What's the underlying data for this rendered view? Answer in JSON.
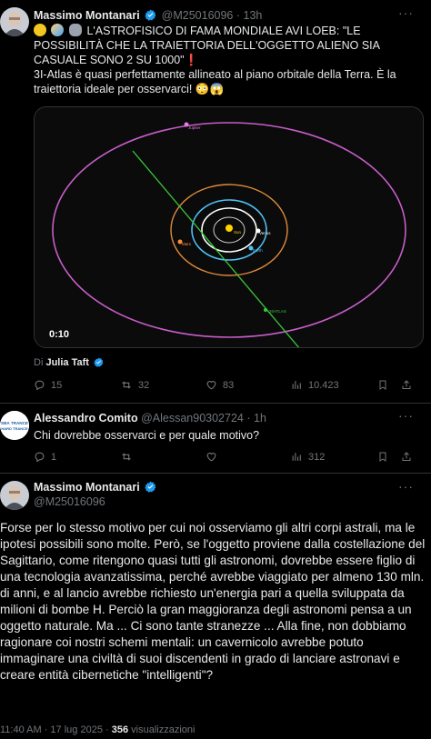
{
  "tweet1": {
    "author_name": "Massimo Montanari",
    "author_handle": "@M25016096",
    "time": "13h",
    "text_line1": "L'ASTROFISICO DI FAMA MONDIALE AVI LOEB: \"LE POSSIBILITÀ CHE LA TRAIETTORIA DELL'OGGETTO ALIENO SIA CASUALE SONO 2 SU 1000\"",
    "exclamation": "❗",
    "text_line2": "3I-Atlas è quasi perfettamente allineato al piano orbitale della Terra. È la traiettoria ideale per  osservarci!",
    "emojis": [
      "😳",
      "😱"
    ],
    "video_time": "0:10",
    "video_labels": {
      "jupiter": "Jupiter",
      "mars": "Mars",
      "venus": "Venus",
      "earth": "Earth",
      "sun": "Sun",
      "atlas": "3I/ATLAS"
    },
    "by_prefix": "Di",
    "by_name": "Julia Taft",
    "replies": "15",
    "reposts": "32",
    "likes": "83",
    "views": "10.423"
  },
  "reply": {
    "author_name": "Alessandro Comito",
    "author_handle": "@Alessan90302724",
    "time": "1h",
    "avatar_text_1": "SBA TRANCE",
    "avatar_text_2": "HARD TRANCE",
    "text": "Chi dovrebbe osservarci e per quale motivo?",
    "replies": "1",
    "views": "312"
  },
  "main": {
    "author_name": "Massimo Montanari",
    "author_handle": "@M25016096",
    "text": "Forse per lo stesso motivo per cui noi osserviamo gli altri corpi astrali, ma le ipotesi possibili sono molte. Però, se l'oggetto proviene dalla costellazione del Sagittario, come ritengono quasi tutti gli astronomi, dovrebbe essere figlio di una tecnologia avanzatissima, perché avrebbe viaggiato per almeno 130 mln. di anni, e al lancio avrebbe richiesto un'energia pari a quella sviluppata da milioni di bombe H. Perciò la gran maggioranza degli astronomi pensa a un oggetto naturale. Ma ... Ci sono tante stranezze ... Alla fine, non dobbiamo ragionare coi nostri schemi mentali: un cavernicolo avrebbe potuto immaginare una civiltà di suoi discendenti in grado di lanciare astronavi e creare entità cibernetiche \"intelligenti\"?",
    "time": "11:40 AM · 17 lug 2025 · ",
    "views_count": "356",
    "views_label": " visualizzazioni"
  },
  "colors": {
    "background": "#000000",
    "text": "#e7e9ea",
    "muted": "#71767b",
    "verified": "#1d9bf0",
    "divider": "#2f3336"
  }
}
